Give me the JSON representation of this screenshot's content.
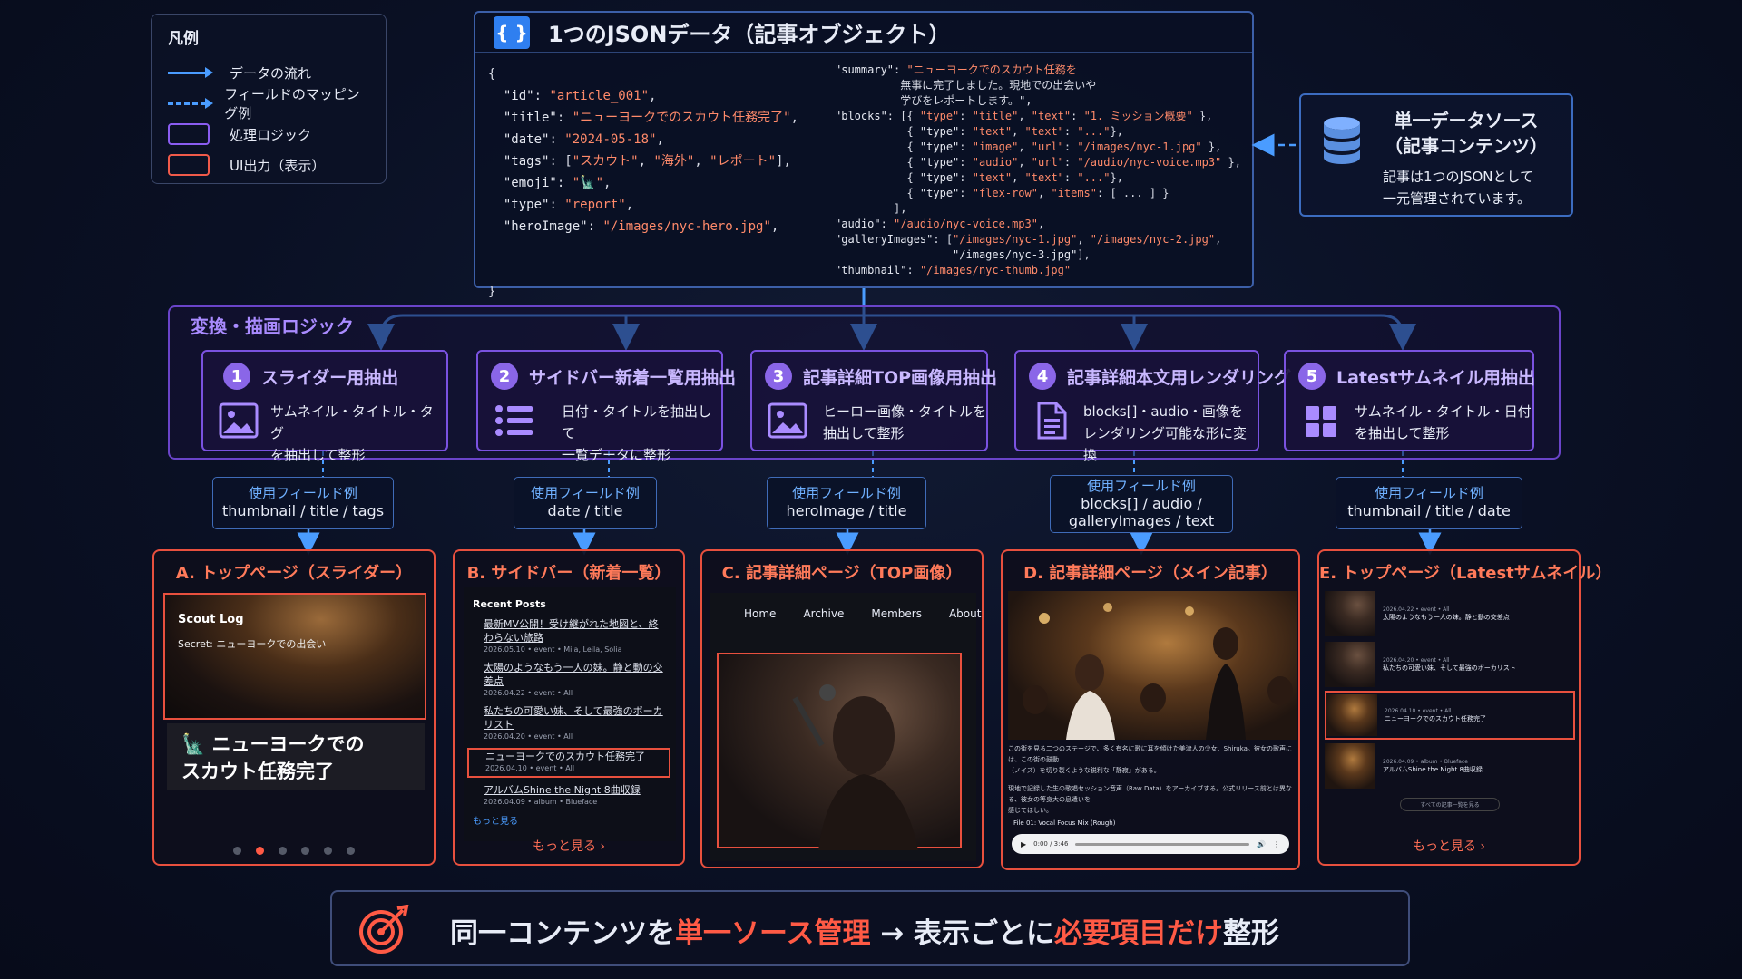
{
  "legend": {
    "title": "凡例",
    "items": [
      "データの流れ",
      "フィールドのマッピング例",
      "処理ロジック",
      "UI出力（表示）"
    ]
  },
  "json_panel": {
    "badge": "{ }",
    "title": "1つのJSONデータ（記事オブジェクト）",
    "left_code": [
      "{",
      "  \"id\": \"article_001\",",
      "  \"title\": \"ニューヨークでのスカウト任務完了\",",
      "  \"date\": \"2024-05-18\",",
      "  \"tags\": [\"スカウト\", \"海外\", \"レポート\"],",
      "  \"emoji\": \"🗽\",",
      "  \"type\": \"report\",",
      "  \"heroImage\": \"/images/nyc-hero.jpg\",",
      "",
      "",
      "}"
    ],
    "right_code": [
      "\"summary\": \"ニューヨークでのスカウト任務を",
      "          無事に完了しました。現地での出会いや",
      "          学びをレポートします。\",",
      "\"blocks\": [{ \"type\": \"title\", \"text\": \"1. ミッション概要\" },",
      "           { \"type\": \"text\", \"text\": \"...\"},",
      "           { \"type\": \"image\", \"url\": \"/images/nyc-1.jpg\" },",
      "           { \"type\": \"audio\", \"url\": \"/audio/nyc-voice.mp3\" },",
      "           { \"type\": \"text\", \"text\": \"...\"},",
      "           { \"type\": \"flex-row\", \"items\": [ ... ] }",
      "         ],",
      "\"audio\": \"/audio/nyc-voice.mp3\",",
      "\"galleryImages\": [\"/images/nyc-1.jpg\", \"/images/nyc-2.jpg\",",
      "                  \"/images/nyc-3.jpg\"],",
      "\"thumbnail\": \"/images/nyc-thumb.jpg\""
    ]
  },
  "source": {
    "title_line1": "単一データソース",
    "title_line2": "（記事コンテンツ）",
    "desc_line1": "記事は1つのJSONとして",
    "desc_line2": "一元管理されています。"
  },
  "logic": {
    "title": "変換・描画ロジック",
    "steps": [
      {
        "num": "1",
        "title": "スライダー用抽出",
        "desc1": "サムネイル・タイトル・タグ",
        "desc2": "を抽出して整形",
        "icon": "image-icon"
      },
      {
        "num": "2",
        "title": "サイドバー新着一覧用抽出",
        "desc1": "日付・タイトルを抽出して",
        "desc2": "一覧データに整形",
        "icon": "list-icon"
      },
      {
        "num": "3",
        "title": "記事詳細TOP画像用抽出",
        "desc1": "ヒーロー画像・タイトルを",
        "desc2": "抽出して整形",
        "icon": "image-icon"
      },
      {
        "num": "4",
        "title": "記事詳細本文用レンダリング",
        "desc1": "blocks[]・audio・画像を",
        "desc2": "レンダリング可能な形に変換",
        "icon": "document-icon"
      },
      {
        "num": "5",
        "title": "Latestサムネイル用抽出",
        "desc1": "サムネイル・タイトル・日付",
        "desc2": "を抽出して整形",
        "icon": "grid-icon"
      }
    ]
  },
  "fields": [
    {
      "label": "使用フィールド例",
      "value": "thumbnail / title / tags"
    },
    {
      "label": "使用フィールド例",
      "value": "date / title"
    },
    {
      "label": "使用フィールド例",
      "value": "heroImage / title"
    },
    {
      "label": "使用フィールド例",
      "value": "blocks[] / audio /",
      "value2": "galleryImages / text"
    },
    {
      "label": "使用フィールド例",
      "value": "thumbnail / title / date"
    }
  ],
  "cards": {
    "a": {
      "title": "A. トップページ（スライダー）",
      "brand": "Scout Log",
      "subtitle": "Secret: ニューヨークでの出会い",
      "caption1": "🗽 ニューヨークでの",
      "caption2": "スカウト任務完了"
    },
    "b": {
      "title": "B. サイドバー（新着一覧）",
      "heading": "Recent Posts",
      "items": [
        {
          "title": "最新MV公開！受け継がれた地図と、終わらない旅路",
          "meta": "2026.05.10 • event • Mila, Leila, Solia"
        },
        {
          "title": "太陽のようなもう一人の妹。静と動の交差点",
          "meta": "2026.04.22 • event • All"
        },
        {
          "title": "私たちの可愛い妹、そして最強のボーカリスト",
          "meta": "2026.04.20 • event • All"
        },
        {
          "title": "ニューヨークでのスカウト任務完了",
          "meta": "2026.04.10 • event • All"
        },
        {
          "title": "アルバムShine the Night 8曲収録",
          "meta": "2026.04.09 • album • Blueface"
        }
      ],
      "inner_more": "もっと見る",
      "more": "もっと見る ›"
    },
    "c": {
      "title": "C. 記事詳細ページ（TOP画像）",
      "nav": [
        "Home",
        "Archive",
        "Members",
        "About"
      ]
    },
    "d": {
      "title": "D. 記事詳細ページ（メイン記事）",
      "body1": "この街を見る二つのステージで、多く有名に歌に耳を傾けた美津人の少女、Shiruka。彼女の歌声には、この街の鼓動",
      "body2": "（ノイズ）を切り裂くような鋭利な「静寂」がある。",
      "body3": "現地で記録した生の歌唱セッション音声（Raw Data）をアーカイブする。公式リリース前とは異なる、彼女の等身大の息遣いを",
      "body4": "感じてほしい。",
      "audio_label": "File 01: Vocal Focus Mix (Rough)",
      "audio_time": "0:00 / 3:46"
    },
    "e": {
      "title": "E. トップページ（Latestサムネイル）",
      "items": [
        {
          "meta": "2026.04.22 • event • All",
          "title": "太陽のようなもう一人の妹。静と動の交差点"
        },
        {
          "meta": "2026.04.20 • event • All",
          "title": "私たちの可愛い妹、そして最強のボーカリスト"
        },
        {
          "meta": "2026.04.10 • event • All",
          "title": "ニューヨークでのスカウト任務完了"
        },
        {
          "meta": "2026.04.09 • album • Blueface",
          "title": "アルバムShine the Night 8曲収録"
        }
      ],
      "all": "すべての記事一覧を見る",
      "more": "もっと見る ›"
    }
  },
  "banner": {
    "p1": "同一コンテンツを",
    "p2": "単一ソース管理",
    "p3": " → 表示ごとに",
    "p4": "必要項目だけ",
    "p5": "整形"
  },
  "colors": {
    "flow": "#4a9cff",
    "logic": "#7a52e0",
    "output": "#e8503e",
    "accent": "#ff5a45"
  }
}
